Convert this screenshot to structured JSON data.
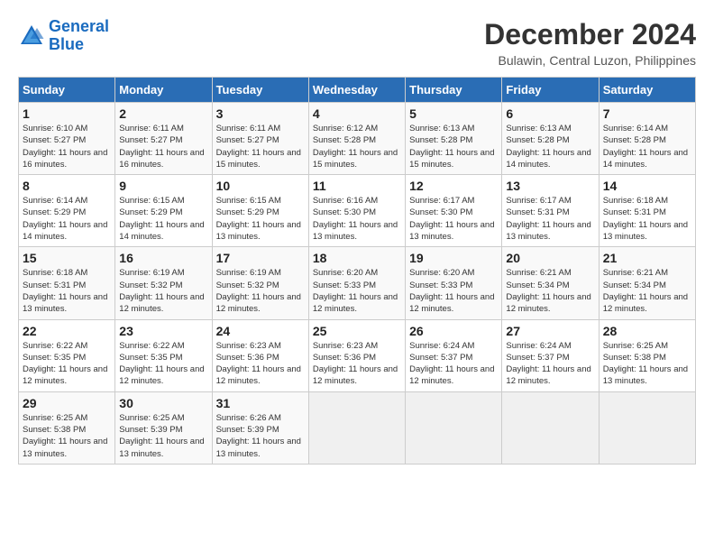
{
  "header": {
    "logo_line1": "General",
    "logo_line2": "Blue",
    "month_title": "December 2024",
    "location": "Bulawin, Central Luzon, Philippines"
  },
  "weekdays": [
    "Sunday",
    "Monday",
    "Tuesday",
    "Wednesday",
    "Thursday",
    "Friday",
    "Saturday"
  ],
  "weeks": [
    [
      {
        "day": "1",
        "sunrise": "Sunrise: 6:10 AM",
        "sunset": "Sunset: 5:27 PM",
        "daylight": "Daylight: 11 hours and 16 minutes."
      },
      {
        "day": "2",
        "sunrise": "Sunrise: 6:11 AM",
        "sunset": "Sunset: 5:27 PM",
        "daylight": "Daylight: 11 hours and 16 minutes."
      },
      {
        "day": "3",
        "sunrise": "Sunrise: 6:11 AM",
        "sunset": "Sunset: 5:27 PM",
        "daylight": "Daylight: 11 hours and 15 minutes."
      },
      {
        "day": "4",
        "sunrise": "Sunrise: 6:12 AM",
        "sunset": "Sunset: 5:28 PM",
        "daylight": "Daylight: 11 hours and 15 minutes."
      },
      {
        "day": "5",
        "sunrise": "Sunrise: 6:13 AM",
        "sunset": "Sunset: 5:28 PM",
        "daylight": "Daylight: 11 hours and 15 minutes."
      },
      {
        "day": "6",
        "sunrise": "Sunrise: 6:13 AM",
        "sunset": "Sunset: 5:28 PM",
        "daylight": "Daylight: 11 hours and 14 minutes."
      },
      {
        "day": "7",
        "sunrise": "Sunrise: 6:14 AM",
        "sunset": "Sunset: 5:28 PM",
        "daylight": "Daylight: 11 hours and 14 minutes."
      }
    ],
    [
      {
        "day": "8",
        "sunrise": "Sunrise: 6:14 AM",
        "sunset": "Sunset: 5:29 PM",
        "daylight": "Daylight: 11 hours and 14 minutes."
      },
      {
        "day": "9",
        "sunrise": "Sunrise: 6:15 AM",
        "sunset": "Sunset: 5:29 PM",
        "daylight": "Daylight: 11 hours and 14 minutes."
      },
      {
        "day": "10",
        "sunrise": "Sunrise: 6:15 AM",
        "sunset": "Sunset: 5:29 PM",
        "daylight": "Daylight: 11 hours and 13 minutes."
      },
      {
        "day": "11",
        "sunrise": "Sunrise: 6:16 AM",
        "sunset": "Sunset: 5:30 PM",
        "daylight": "Daylight: 11 hours and 13 minutes."
      },
      {
        "day": "12",
        "sunrise": "Sunrise: 6:17 AM",
        "sunset": "Sunset: 5:30 PM",
        "daylight": "Daylight: 11 hours and 13 minutes."
      },
      {
        "day": "13",
        "sunrise": "Sunrise: 6:17 AM",
        "sunset": "Sunset: 5:31 PM",
        "daylight": "Daylight: 11 hours and 13 minutes."
      },
      {
        "day": "14",
        "sunrise": "Sunrise: 6:18 AM",
        "sunset": "Sunset: 5:31 PM",
        "daylight": "Daylight: 11 hours and 13 minutes."
      }
    ],
    [
      {
        "day": "15",
        "sunrise": "Sunrise: 6:18 AM",
        "sunset": "Sunset: 5:31 PM",
        "daylight": "Daylight: 11 hours and 13 minutes."
      },
      {
        "day": "16",
        "sunrise": "Sunrise: 6:19 AM",
        "sunset": "Sunset: 5:32 PM",
        "daylight": "Daylight: 11 hours and 12 minutes."
      },
      {
        "day": "17",
        "sunrise": "Sunrise: 6:19 AM",
        "sunset": "Sunset: 5:32 PM",
        "daylight": "Daylight: 11 hours and 12 minutes."
      },
      {
        "day": "18",
        "sunrise": "Sunrise: 6:20 AM",
        "sunset": "Sunset: 5:33 PM",
        "daylight": "Daylight: 11 hours and 12 minutes."
      },
      {
        "day": "19",
        "sunrise": "Sunrise: 6:20 AM",
        "sunset": "Sunset: 5:33 PM",
        "daylight": "Daylight: 11 hours and 12 minutes."
      },
      {
        "day": "20",
        "sunrise": "Sunrise: 6:21 AM",
        "sunset": "Sunset: 5:34 PM",
        "daylight": "Daylight: 11 hours and 12 minutes."
      },
      {
        "day": "21",
        "sunrise": "Sunrise: 6:21 AM",
        "sunset": "Sunset: 5:34 PM",
        "daylight": "Daylight: 11 hours and 12 minutes."
      }
    ],
    [
      {
        "day": "22",
        "sunrise": "Sunrise: 6:22 AM",
        "sunset": "Sunset: 5:35 PM",
        "daylight": "Daylight: 11 hours and 12 minutes."
      },
      {
        "day": "23",
        "sunrise": "Sunrise: 6:22 AM",
        "sunset": "Sunset: 5:35 PM",
        "daylight": "Daylight: 11 hours and 12 minutes."
      },
      {
        "day": "24",
        "sunrise": "Sunrise: 6:23 AM",
        "sunset": "Sunset: 5:36 PM",
        "daylight": "Daylight: 11 hours and 12 minutes."
      },
      {
        "day": "25",
        "sunrise": "Sunrise: 6:23 AM",
        "sunset": "Sunset: 5:36 PM",
        "daylight": "Daylight: 11 hours and 12 minutes."
      },
      {
        "day": "26",
        "sunrise": "Sunrise: 6:24 AM",
        "sunset": "Sunset: 5:37 PM",
        "daylight": "Daylight: 11 hours and 12 minutes."
      },
      {
        "day": "27",
        "sunrise": "Sunrise: 6:24 AM",
        "sunset": "Sunset: 5:37 PM",
        "daylight": "Daylight: 11 hours and 12 minutes."
      },
      {
        "day": "28",
        "sunrise": "Sunrise: 6:25 AM",
        "sunset": "Sunset: 5:38 PM",
        "daylight": "Daylight: 11 hours and 13 minutes."
      }
    ],
    [
      {
        "day": "29",
        "sunrise": "Sunrise: 6:25 AM",
        "sunset": "Sunset: 5:38 PM",
        "daylight": "Daylight: 11 hours and 13 minutes."
      },
      {
        "day": "30",
        "sunrise": "Sunrise: 6:25 AM",
        "sunset": "Sunset: 5:39 PM",
        "daylight": "Daylight: 11 hours and 13 minutes."
      },
      {
        "day": "31",
        "sunrise": "Sunrise: 6:26 AM",
        "sunset": "Sunset: 5:39 PM",
        "daylight": "Daylight: 11 hours and 13 minutes."
      },
      null,
      null,
      null,
      null
    ]
  ]
}
